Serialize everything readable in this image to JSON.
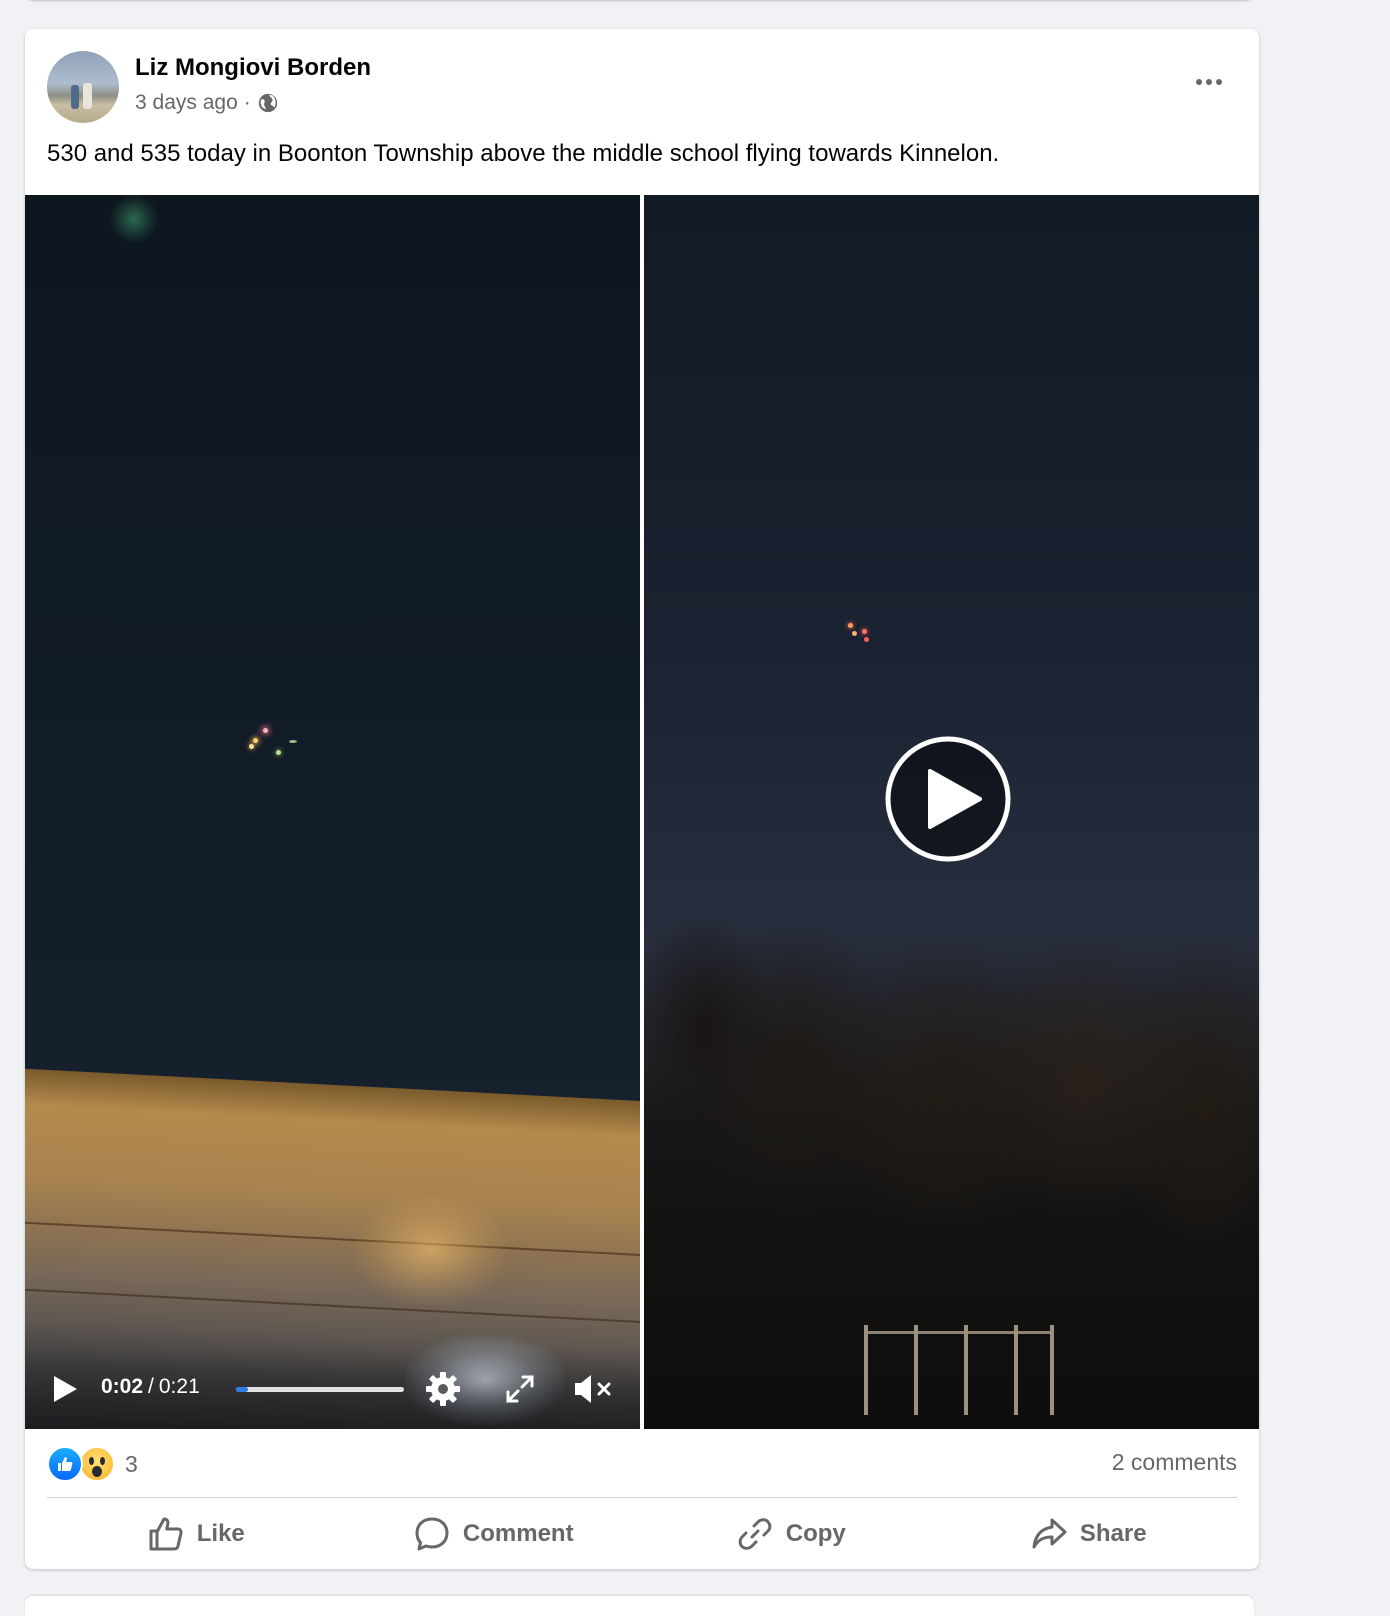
{
  "post": {
    "author": "Liz Mongiovi Borden",
    "timestamp": "3 days ago",
    "separator": "·",
    "audience_icon": "globe-icon",
    "menu_icon": "more-horizontal-icon",
    "text": "530 and 535 today in Boonton Township above the middle school flying towards Kinnelon."
  },
  "video_left": {
    "current_time": "0:02",
    "time_separator": "/",
    "duration": "0:21",
    "progress_fraction": 0.07,
    "icons": [
      "play-icon",
      "settings-gear-icon",
      "fullscreen-icon",
      "muted-speaker-icon"
    ]
  },
  "video_right": {
    "overlay_icon": "play-circle-icon"
  },
  "stats": {
    "reaction_icons": [
      "like-reaction-icon",
      "wow-reaction-icon"
    ],
    "reaction_count": "3",
    "comments": "2 comments"
  },
  "actions": [
    {
      "label": "Like",
      "icon": "thumbs-up-icon"
    },
    {
      "label": "Comment",
      "icon": "comment-bubble-icon"
    },
    {
      "label": "Copy",
      "icon": "link-icon"
    },
    {
      "label": "Share",
      "icon": "share-arrow-icon"
    }
  ],
  "colors": {
    "page_background": "#f0f2f5",
    "secondary_text": "#65676b",
    "like_blue": "#0866ff",
    "progress_blue": "#2d7de6"
  }
}
